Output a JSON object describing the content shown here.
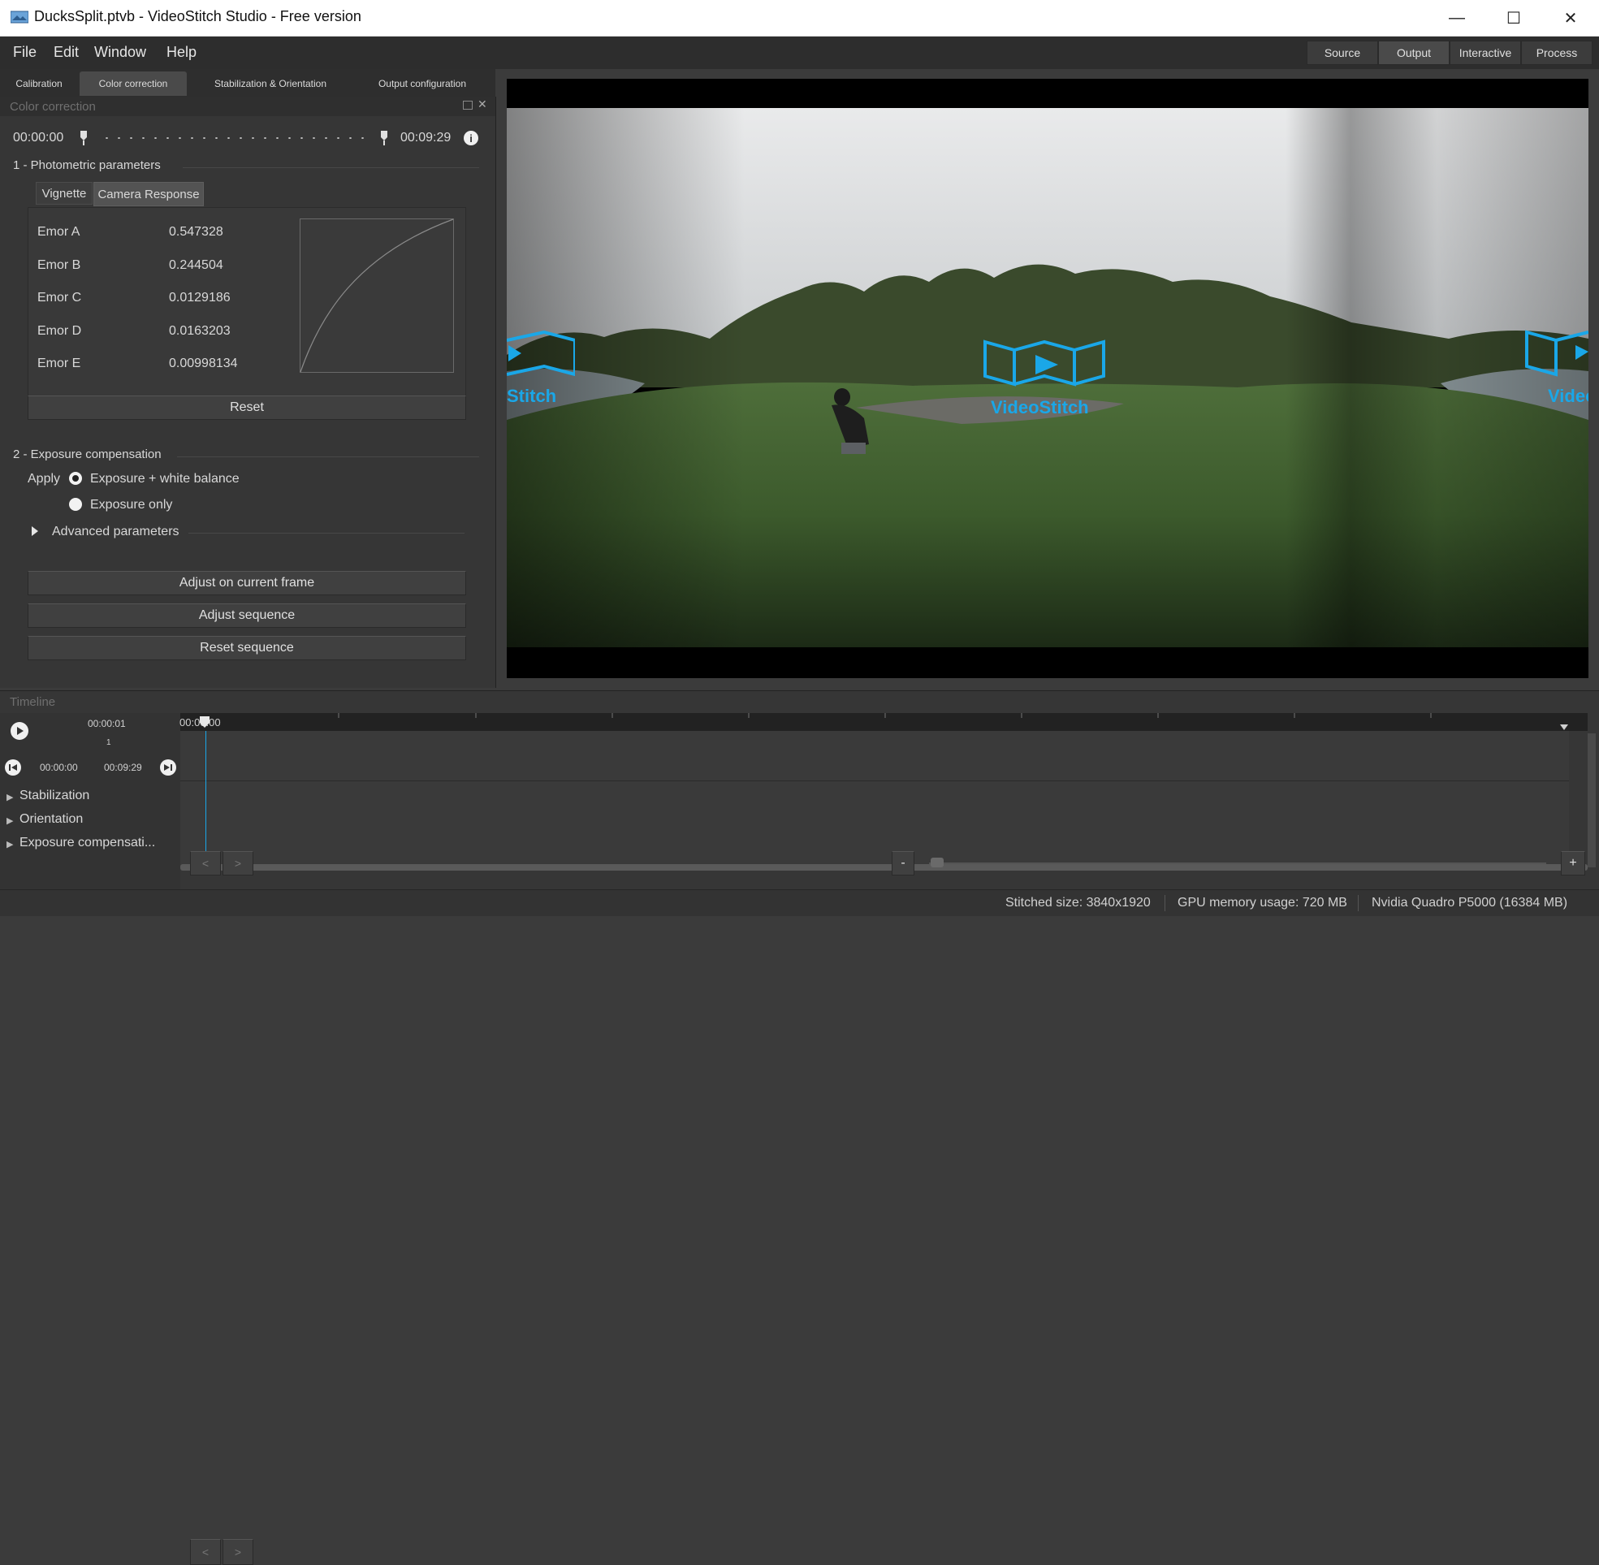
{
  "window": {
    "title": "DucksSplit.ptvb - VideoStitch Studio - Free version",
    "minimize_label": "—",
    "maximize_label": "☐",
    "close_label": "✕"
  },
  "menu": [
    "File",
    "Edit",
    "Window",
    "Help"
  ],
  "modes": [
    {
      "label": "Source",
      "active": false
    },
    {
      "label": "Output",
      "active": true
    },
    {
      "label": "Interactive",
      "active": false
    },
    {
      "label": "Process",
      "active": false
    }
  ],
  "tabs": [
    {
      "label": "Calibration"
    },
    {
      "label": "Color correction"
    },
    {
      "label": "Stabilization & Orientation"
    },
    {
      "label": "Output configuration"
    }
  ],
  "color_correction": {
    "panel_title": "Color correction",
    "range_start": "00:00:00",
    "range_end": "00:09:29",
    "photometric_title": "1 - Photometric parameters",
    "subtabs": [
      "Vignette",
      "Camera Response"
    ],
    "emor": [
      {
        "name": "Emor A",
        "value": "0.547328"
      },
      {
        "name": "Emor B",
        "value": "0.244504"
      },
      {
        "name": "Emor C",
        "value": "0.0129186"
      },
      {
        "name": "Emor D",
        "value": "0.0163203"
      },
      {
        "name": "Emor E",
        "value": "0.00998134"
      }
    ],
    "reset_label": "Reset",
    "exposure_title": "2 - Exposure compensation",
    "apply_label": "Apply",
    "radio_options": [
      {
        "label": "Exposure + white balance",
        "checked": true
      },
      {
        "label": "Exposure only",
        "checked": false
      }
    ],
    "advanced_label": "Advanced parameters",
    "adjust_current_label": "Adjust on current frame",
    "adjust_sequence_label": "Adjust sequence",
    "reset_sequence_label": "Reset sequence"
  },
  "preview": {
    "watermark": "VideoStitch",
    "watermark_left_fragment": "Stitch",
    "watermark_right_fragment": "Video",
    "accent_color": "#1aa7e8"
  },
  "timeline": {
    "title": "Timeline",
    "current_time": "00:00:01",
    "current_frame": "1",
    "start_time": "00:00:00",
    "end_time": "00:09:29",
    "ruler_label": "00:00:00",
    "tracks": [
      "Stabilization",
      "Orientation",
      "Exposure compensati..."
    ],
    "prev_label": "<",
    "next_label": ">",
    "zoom_out_label": "-",
    "zoom_in_label": "+"
  },
  "status": {
    "stitched_size": "Stitched size: 3840x1920",
    "gpu_memory": "GPU memory usage: 720 MB",
    "gpu_name": "Nvidia Quadro P5000 (16384 MB)"
  }
}
